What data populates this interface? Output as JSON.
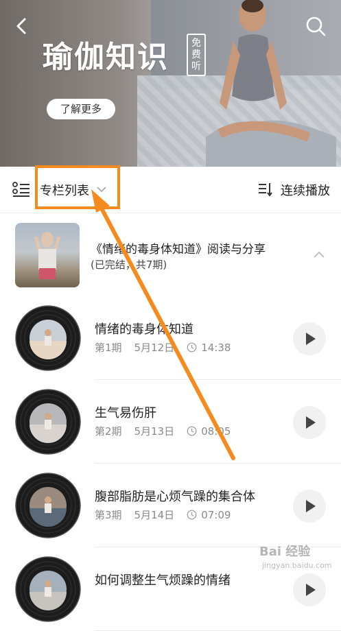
{
  "header": {
    "title": "瑜伽知识",
    "free_badge": [
      "免",
      "费",
      "听"
    ],
    "learn_more": "了解更多"
  },
  "toolbar": {
    "list_label": "专栏列表",
    "continuous_play": "连续播放"
  },
  "section": {
    "title": "《情绪的毒身体知道》阅读与分享",
    "subtitle": "(已完结，共7期)"
  },
  "episodes": [
    {
      "title": "情绪的毒身体知道",
      "period": "第1期",
      "date": "5月12日",
      "duration": "14:38"
    },
    {
      "title": "生气易伤肝",
      "period": "第2期",
      "date": "5月13日",
      "duration": "08:05"
    },
    {
      "title": "腹部脂肪是心烦气躁的集合体",
      "period": "第3期",
      "date": "5月14日",
      "duration": "07:09"
    },
    {
      "title": "如何调整生气烦躁的情绪",
      "period": "",
      "date": "",
      "duration": ""
    }
  ],
  "watermark": {
    "text": "Bai 经验",
    "url": "jingyan.baidu.com"
  },
  "colors": {
    "highlight": "#f58b1f",
    "text": "#222222",
    "meta": "#8a8a8a"
  }
}
